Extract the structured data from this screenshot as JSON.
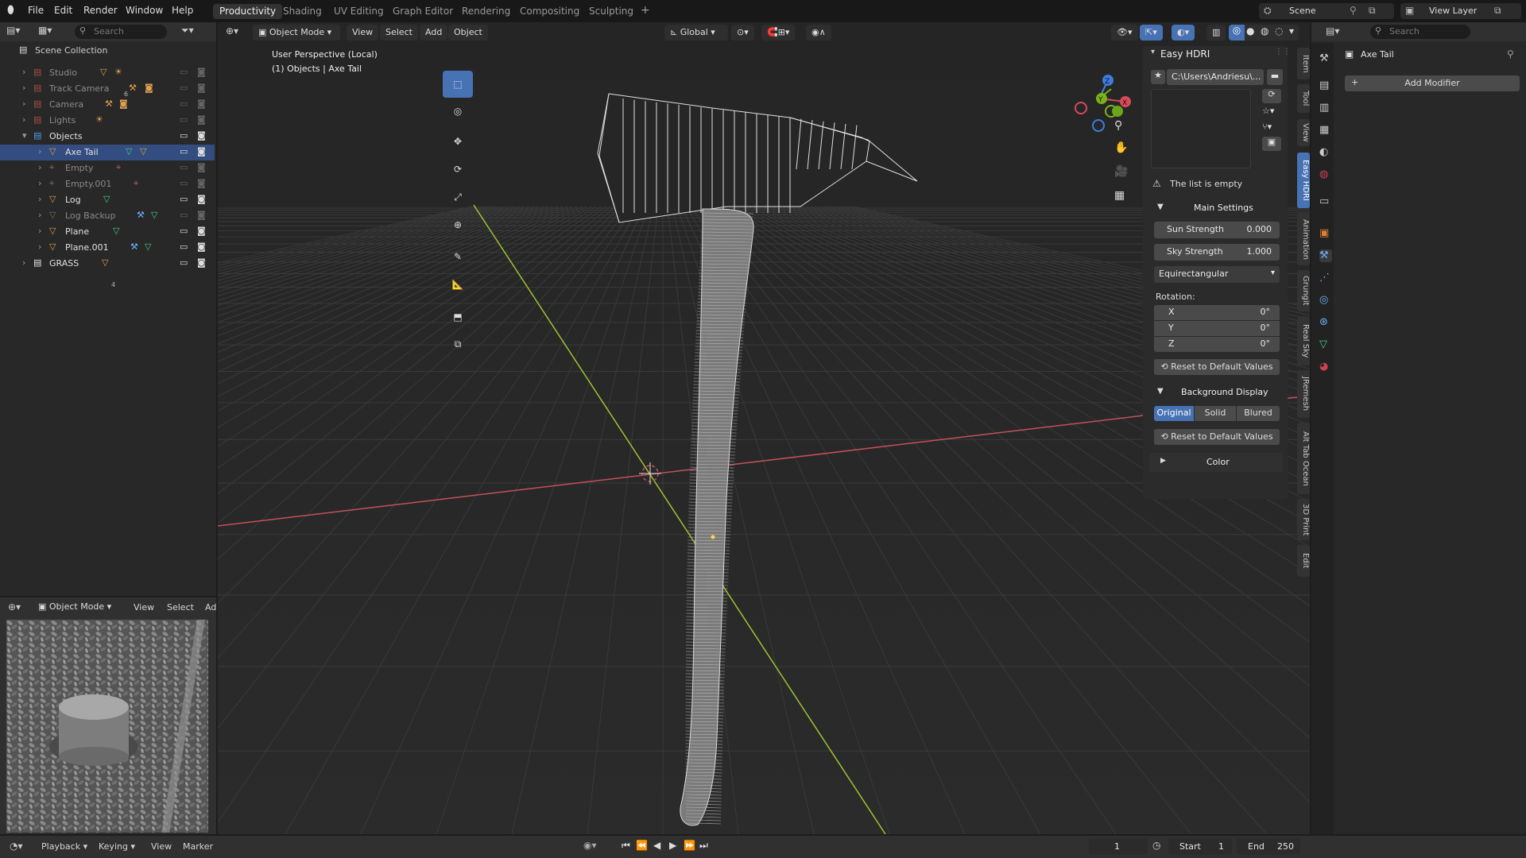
{
  "topbar": {
    "menus": [
      "File",
      "Edit",
      "Render",
      "Window",
      "Help"
    ],
    "workspaces": [
      "Productivity",
      "Shading",
      "UV Editing",
      "Graph Editor",
      "Rendering",
      "Compositing",
      "Sculpting"
    ],
    "active_workspace": "Productivity",
    "add_workspace": "+",
    "scene_name": "Scene",
    "view_layer": "View Layer"
  },
  "outliner": {
    "search_placeholder": "Search",
    "root": "Scene Collection",
    "items": [
      {
        "label": "Studio",
        "kind": "collection",
        "dim": true
      },
      {
        "label": "Track Camera",
        "kind": "collection",
        "dim": true
      },
      {
        "label": "Camera",
        "kind": "collection",
        "dim": true
      },
      {
        "label": "Lights",
        "kind": "collection",
        "dim": true
      },
      {
        "label": "Objects",
        "kind": "collection",
        "dim": false
      },
      {
        "label": "Axe Tail",
        "kind": "mesh",
        "dim": false
      },
      {
        "label": "Empty",
        "kind": "empty",
        "dim": true
      },
      {
        "label": "Empty.001",
        "kind": "empty",
        "dim": true
      },
      {
        "label": "Log",
        "kind": "mesh",
        "dim": false
      },
      {
        "label": "Log Backup",
        "kind": "mesh",
        "dim": true
      },
      {
        "label": "Plane",
        "kind": "mesh",
        "dim": false
      },
      {
        "label": "Plane.001",
        "kind": "mesh",
        "dim": false
      },
      {
        "label": "GRASS",
        "kind": "collection",
        "dim": false
      }
    ],
    "studio_badge": "6",
    "grass_badge": "4"
  },
  "viewport": {
    "mode": "Object Mode",
    "menus": [
      "View",
      "Select",
      "Add",
      "Object"
    ],
    "orientation": "Global",
    "title": "User Perspective (Local)",
    "subtitle": "(1) Objects | Axe Tail",
    "gizmo": {
      "x": "X",
      "y": "Y",
      "z": "Z"
    }
  },
  "preview": {
    "mode": "Object Mode",
    "menus": [
      "View",
      "Select",
      "Ad"
    ]
  },
  "easy_hdri": {
    "title": "Easy HDRI",
    "path": "C:\\Users\\Andriesu\\...",
    "empty_msg": "The list is empty",
    "main_settings": "Main Settings",
    "sun_label": "Sun Strength",
    "sun_value": "0.000",
    "sky_label": "Sky Strength",
    "sky_value": "1.000",
    "projection": "Equirectangular",
    "rotation_label": "Rotation:",
    "rot_x_label": "X",
    "rot_x": "0°",
    "rot_y_label": "Y",
    "rot_y": "0°",
    "rot_z_label": "Z",
    "rot_z": "0°",
    "reset": "Reset to Default Values",
    "bg_display": "Background Display",
    "bg_options": [
      "Original",
      "Solid",
      "Blured"
    ],
    "bg_selected": "Original",
    "color": "Color"
  },
  "sidebar_tabs": [
    "Item",
    "Tool",
    "View",
    "Easy HDRI",
    "Animation",
    "Grungit",
    "Real Sky",
    "JRemesh",
    "Alt Tab Ocean",
    "3D Print",
    "Edit"
  ],
  "sidebar_active_tab": "Easy HDRI",
  "properties": {
    "search_placeholder": "Search",
    "object_name": "Axe Tail",
    "add_modifier": "Add Modifier"
  },
  "timeline": {
    "menus": [
      "Playback",
      "Keying",
      "View",
      "Marker"
    ],
    "current_frame": "1",
    "start_label": "Start",
    "start": "1",
    "end_label": "End",
    "end": "250"
  },
  "colors": {
    "accent": "#4772b3",
    "x_axis": "#c4505a",
    "y_axis": "#9ec32f",
    "collection": "#e8e8e8",
    "mesh_icon": "#e0a050",
    "modifier_icon": "#6cb3ff",
    "data_icon": "#3fd189"
  }
}
